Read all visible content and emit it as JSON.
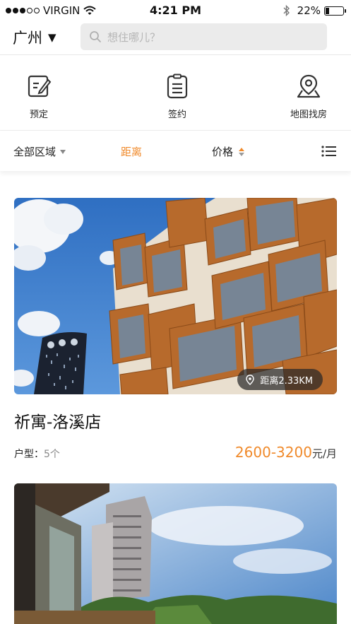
{
  "status_bar": {
    "carrier": "VIRGIN",
    "time": "4:21 PM",
    "battery": "22%",
    "battery_level": 0.22,
    "signal_bars_filled": 3,
    "signal_bars_total": 5
  },
  "header": {
    "city": "广州",
    "city_caret": "▼",
    "search_placeholder": "想住哪儿？"
  },
  "actions": [
    {
      "label": "预定",
      "icon": "edit-note-icon"
    },
    {
      "label": "签约",
      "icon": "contract-document-icon"
    },
    {
      "label": "地图找房",
      "icon": "map-pin-icon"
    }
  ],
  "filters": {
    "area": "全部区域",
    "distance": "距离",
    "price": "价格",
    "active": "距离",
    "menu_icon": "list-menu-icon"
  },
  "listings": [
    {
      "name": "祈寓-洛溪店",
      "distance_label": "距离2.33KM",
      "room_type_label": "户型：",
      "room_type_count": "5个",
      "price_range": "2600-3200",
      "price_unit": "元/月"
    }
  ],
  "colors": {
    "accent": "#f08a2b",
    "search_bg": "#ebebeb",
    "text": "#222222"
  }
}
